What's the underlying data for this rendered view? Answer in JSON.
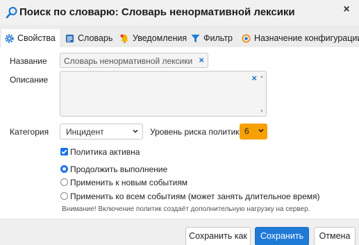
{
  "window": {
    "title": "Поиск по словарю: Словарь ненормативной лексики",
    "close_glyph": "×"
  },
  "tabs": [
    {
      "label": "Свойства",
      "icon": "gear-icon",
      "active": true
    },
    {
      "label": "Словарь",
      "icon": "dictionary-icon",
      "active": false
    },
    {
      "label": "Уведомления",
      "icon": "bell-icon",
      "active": false
    },
    {
      "label": "Фильтр",
      "icon": "funnel-icon",
      "active": false
    },
    {
      "label": "Назначение конфигурации",
      "icon": "target-icon",
      "active": false
    }
  ],
  "form": {
    "name_label": "Название",
    "name_value": "Словарь ненормативной лексики",
    "description_label": "Описание",
    "description_value": "",
    "category_label": "Категория",
    "category_value": "Инцидент",
    "risk_label": "Уровень риска политики",
    "risk_value": "6",
    "risk_color": "#f7a000",
    "active_label": "Политика активна",
    "active_checked": true,
    "radio_options": [
      {
        "label": "Продолжить выполнение",
        "selected": true
      },
      {
        "label": "Применить к новым событиям",
        "selected": false
      },
      {
        "label": "Применить ко всем событиям (может занять длительное время)",
        "selected": false
      }
    ],
    "note": "Внимание! Включение политик создаёт дополнительную нагрузку на сервер.",
    "clear_glyph": "×"
  },
  "footer": {
    "save_as_label": "Сохранить как",
    "save_label": "Сохранить",
    "cancel_label": "Отмена"
  },
  "colors": {
    "accent": "#1f7ad6",
    "check": "#1a73e8"
  }
}
